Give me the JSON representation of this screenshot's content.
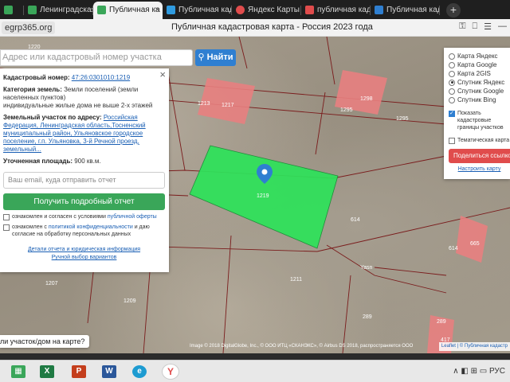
{
  "browser": {
    "tabs": [
      {
        "label": "egrp365",
        "icon": "site-icon",
        "color": "#3aa659"
      },
      {
        "label": "Ленинградская",
        "icon": "check-icon",
        "color": "#3aa659"
      },
      {
        "label": "Публичная ка",
        "icon": "check-icon",
        "color": "#3aa659"
      },
      {
        "label": "Публичная кад",
        "icon": "map-icon",
        "color": "#2f9be0"
      },
      {
        "label": "Яндекс Карты",
        "icon": "pin-icon",
        "color": "#e04c4c"
      },
      {
        "label": "публичная кад",
        "icon": "yandex-icon",
        "color": "#e04c4c"
      },
      {
        "label": "Публичная кад",
        "icon": "p-icon",
        "color": "#2f7fd1"
      }
    ],
    "new_tab": "+",
    "url": "egrp365.org",
    "page_title": "Публичная кадастровая карта - Россия 2023 года",
    "window_buttons": [
      "⚿",
      "⎕",
      "☰",
      "—"
    ]
  },
  "search": {
    "placeholder": "Адрес или кадастровый номер участка",
    "button_label": "Найти"
  },
  "info": {
    "close": "×",
    "cad_label": "Кадастровый номер:",
    "cad_value": "47:26:0301010:1219",
    "cat_label": "Категория земель:",
    "cat_value": "Земли поселений (земли населенных пунктов)",
    "use_value": "индивидуальные жилые дома не выше 2-х этажей",
    "addr_label": "Земельный участок по адресу:",
    "addr_value": "Российская Федерация, Ленинградская область,Тосненский муниципальный район, Ульяновское городское поселение, г.п. Ульяновка, 3-й Речной проезд, земельный...",
    "area_label": "Уточненная площадь:",
    "area_value": "900 кв.м.",
    "email_placeholder": "Ваш email, куда отправить отчет",
    "report_button": "Получить подробный отчет",
    "consent1_a": "ознакомлен и согласен с условиями",
    "consent1_link": "публичной оферты",
    "consent2_a": "ознакомлен с",
    "consent2_link": "политикой конфиденциальности",
    "consent2_b": "и даю согласие на обработку персональных данных",
    "link_details": "Детали отчета и юридическая информация",
    "link_manual": "Ручной выбор вариантов"
  },
  "layers": {
    "options": [
      {
        "label": "Карта Яндекс",
        "selected": false
      },
      {
        "label": "Карта Google",
        "selected": false
      },
      {
        "label": "Карта 2GIS",
        "selected": false
      },
      {
        "label": "Спутник Яндекс",
        "selected": true
      },
      {
        "label": "Спутник Google",
        "selected": false
      },
      {
        "label": "Спутник Bing",
        "selected": false
      }
    ],
    "show_borders": "Показать кадастровые границы участков",
    "thematic": "Тематическая карта",
    "share_button": "Поделиться ссылкой",
    "settings_link": "Настроить карту"
  },
  "map": {
    "parcel_labels": [
      "1213",
      "1217",
      "1298",
      "1295",
      "1295",
      "1219",
      "614",
      "614",
      "665",
      "1211",
      "1207",
      "1209",
      "289",
      "289",
      "417",
      "Yasn",
      "1220"
    ],
    "highlight_color": "#2ee25a",
    "building_color": "#e87f7f",
    "bottom_question": "ли участок/дом на карте?",
    "attribution": "Image © 2018 DigitalGlobe, Inc., © ООО ИТЦ «СКАНЭКС», © Airbus DS 2018, распространяется ООО",
    "leaflet": "Leaflet | © Публичная кадастр"
  },
  "taskbar": {
    "tray": "∧ ◧ ⊞ ▭ РУС"
  }
}
